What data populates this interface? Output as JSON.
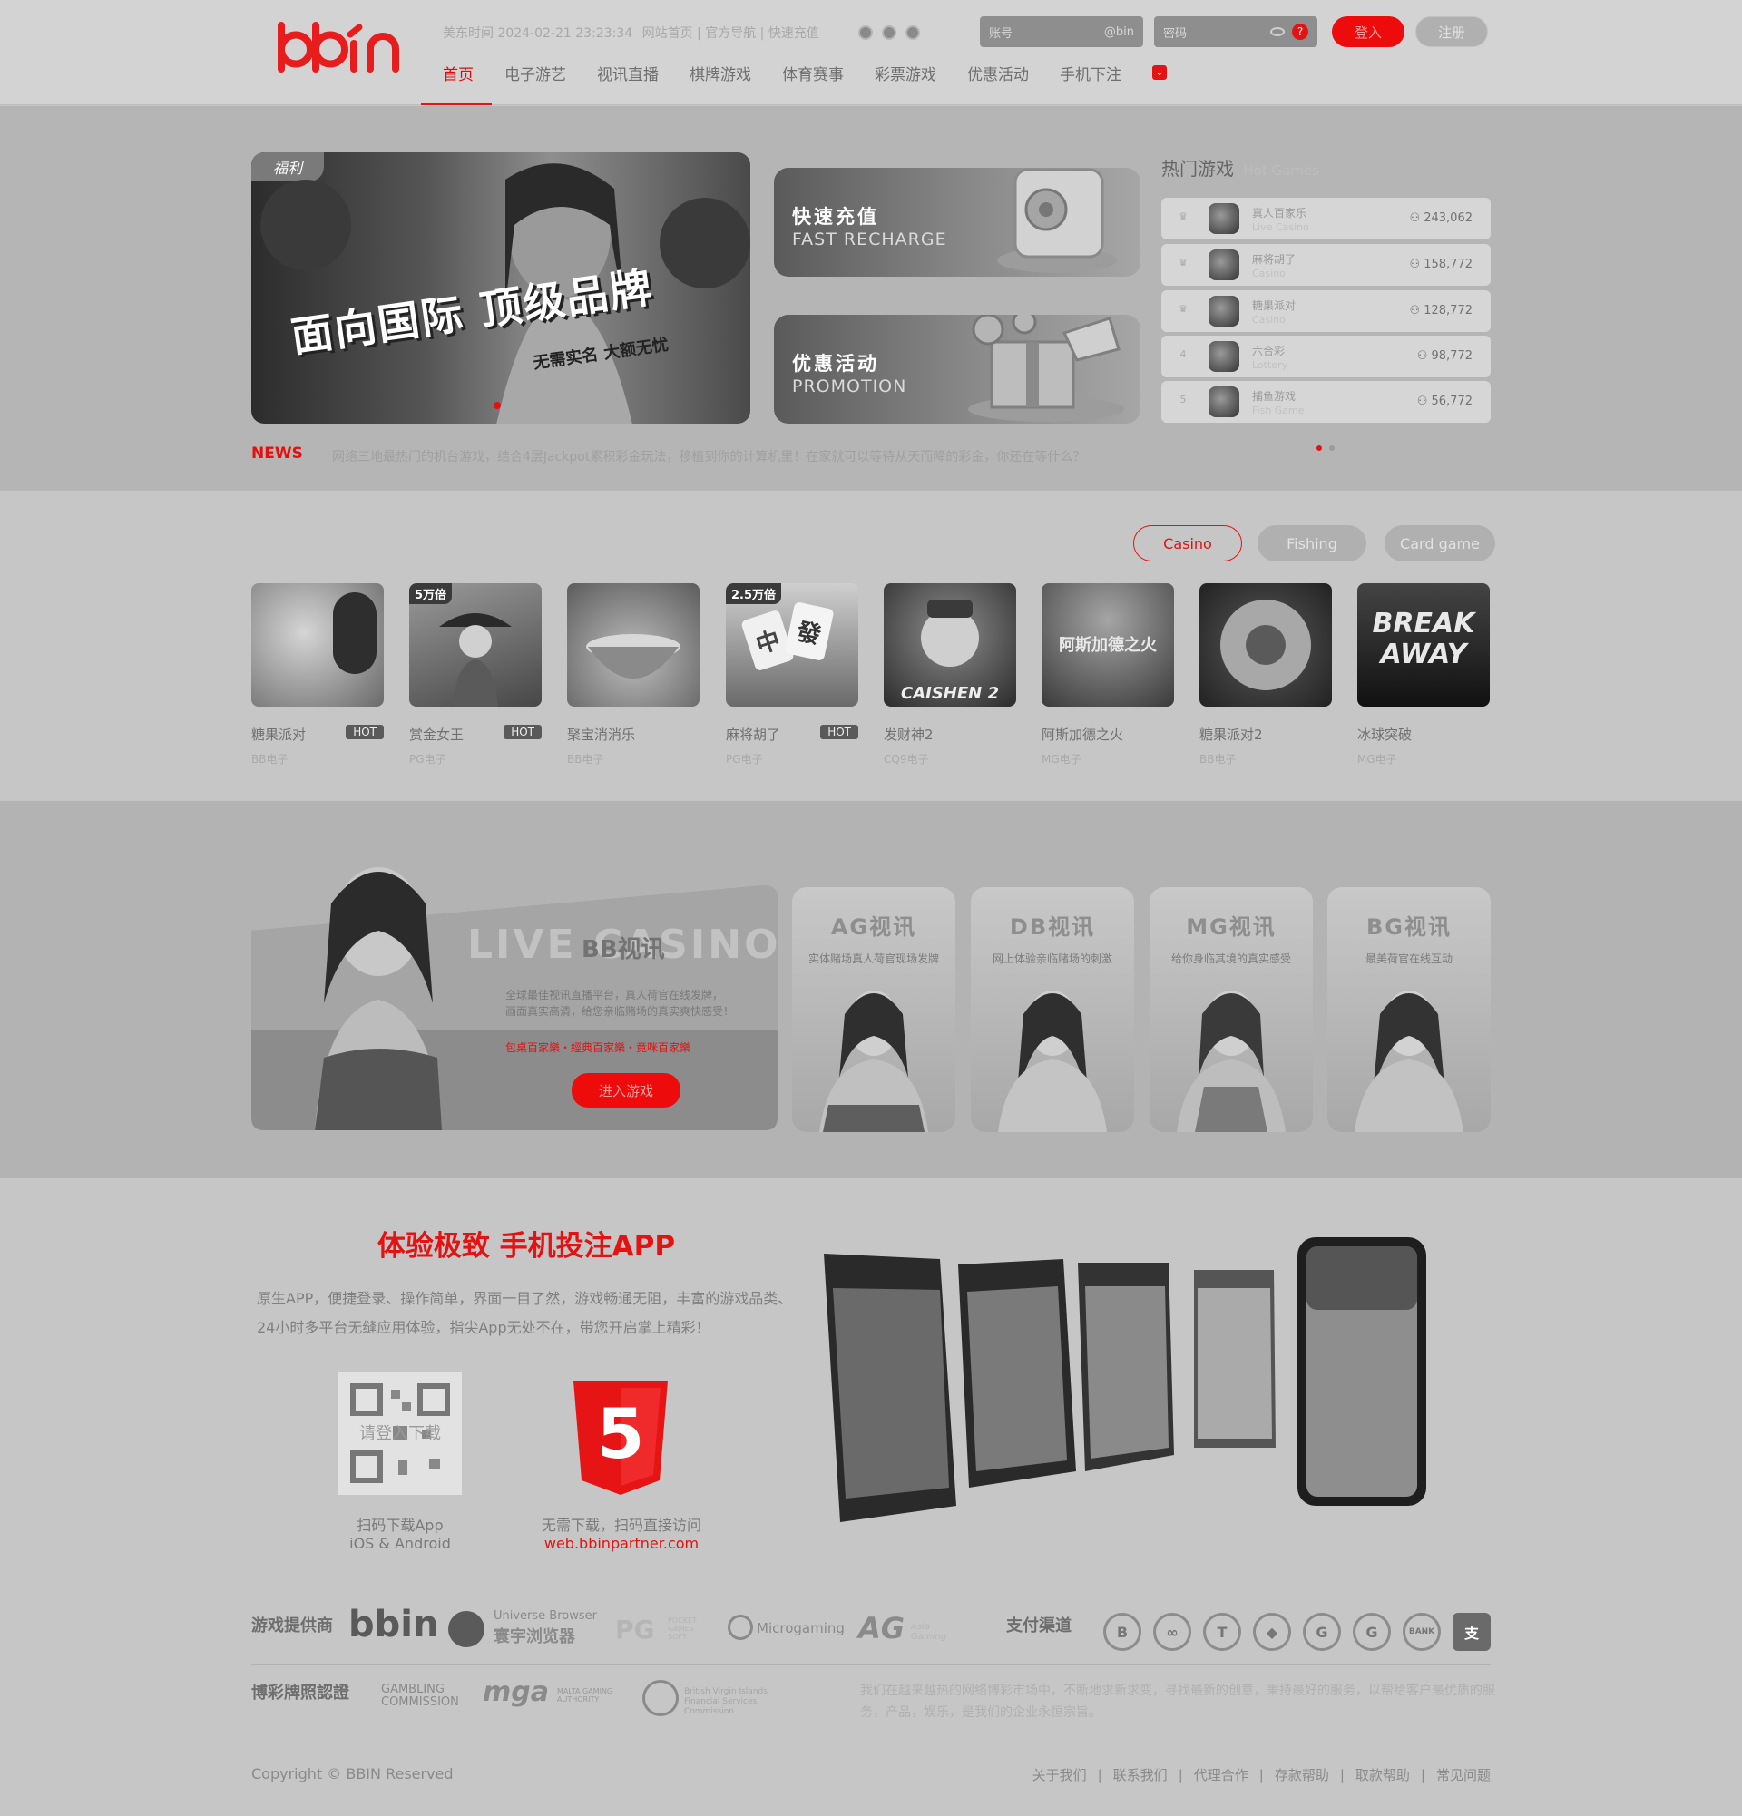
{
  "header": {
    "logo": "bbin",
    "time": "美东时间 2024-02-21 23:23:34",
    "links": "网站首页 | 官方导航 | 快速充值",
    "account_placeholder": "账号",
    "account_suffix": "@bin",
    "password_placeholder": "密码",
    "help_icon": "?",
    "login_label": "登入",
    "register_label": "注册"
  },
  "nav": [
    {
      "label": "首页",
      "active": true
    },
    {
      "label": "电子游艺"
    },
    {
      "label": "视讯直播"
    },
    {
      "label": "棋牌游戏"
    },
    {
      "label": "体育赛事"
    },
    {
      "label": "彩票游戏"
    },
    {
      "label": "优惠活动"
    },
    {
      "label": "手机下注"
    }
  ],
  "banner": {
    "tag": "福利",
    "headline": "面向国际 顶级品牌",
    "sub": "无需实名 大额无忧"
  },
  "promos": [
    {
      "title": "快速充值",
      "subtitle": "FAST RECHARGE"
    },
    {
      "title": "优惠活动",
      "subtitle": "PROMOTION"
    }
  ],
  "hot_games": {
    "title": "热门游戏",
    "subtitle": "Hot Games",
    "items": [
      {
        "rank": "1",
        "name": "真人百家乐",
        "cat": "Live Casino",
        "count": "243,062"
      },
      {
        "rank": "2",
        "name": "麻将胡了",
        "cat": "Casino",
        "count": "158,772"
      },
      {
        "rank": "3",
        "name": "糖果派对",
        "cat": "Casino",
        "count": "128,772"
      },
      {
        "rank": "4",
        "name": "六合彩",
        "cat": "Lottery",
        "count": "98,772"
      },
      {
        "rank": "5",
        "name": "捕鱼游戏",
        "cat": "Fish Game",
        "count": "56,772"
      }
    ]
  },
  "news": {
    "label": "NEWS",
    "text": "网络三地最热门的机台游戏，结合4层Jackpot累积彩金玩法，移植到你的计算机里！在家就可以等待从天而降的彩金，你还在等什么？"
  },
  "game_tabs": [
    "Casino",
    "Fishing",
    "Card game"
  ],
  "games": [
    {
      "name": "糖果派对",
      "vendor": "BB电子",
      "hot": "HOT",
      "badge": ""
    },
    {
      "name": "赏金女王",
      "vendor": "PG电子",
      "hot": "HOT",
      "badge": "5万倍"
    },
    {
      "name": "聚宝消消乐",
      "vendor": "BB电子",
      "hot": "",
      "badge": ""
    },
    {
      "name": "麻将胡了",
      "vendor": "PG电子",
      "hot": "HOT",
      "badge": "2.5万倍"
    },
    {
      "name": "发财神2",
      "vendor": "CQ9电子",
      "hot": "",
      "badge": ""
    },
    {
      "name": "阿斯加德之火",
      "vendor": "MG电子",
      "hot": "",
      "badge": ""
    },
    {
      "name": "糖果派对2",
      "vendor": "BB电子",
      "hot": "",
      "badge": ""
    },
    {
      "name": "冰球突破",
      "vendor": "MG电子",
      "hot": "",
      "badge": ""
    }
  ],
  "game_art": [
    "",
    "",
    "",
    "中 發",
    "CAISHEN 2",
    "阿斯加德之火",
    "",
    "BREAK AWAY"
  ],
  "live": {
    "bg_text": "LIVE CASINO",
    "title": "BB视讯",
    "desc1": "全球最佳视讯直播平台，真人荷官在线发牌，",
    "desc2": "画面真实高清，给您亲临赌场的真实爽快感受！",
    "games": "包桌百家樂・經典百家樂・竟咪百家樂",
    "button": "进入游戏",
    "cards": [
      {
        "title": "AG视讯",
        "sub": "实体赌场真人荷官现场发牌"
      },
      {
        "title": "DB视讯",
        "sub": "网上体验亲临赌场的刺激"
      },
      {
        "title": "MG视讯",
        "sub": "给你身临其境的真实感受"
      },
      {
        "title": "BG视讯",
        "sub": "最美荷官在线互动"
      }
    ]
  },
  "app": {
    "title": "体验极致 手机投注APP",
    "desc1": "原生APP，便捷登录、操作简单，界面一目了然，游戏畅通无阻，丰富的游戏品类、",
    "desc2": "24小时多平台无缝应用体验，指尖App无处不在，带您开启掌上精彩！",
    "qr_text": "请登入下载",
    "qr_caption1": "扫码下载App",
    "qr_caption2": "iOS & Android",
    "h5_caption1": "无需下载，扫码直接访问",
    "h5_url": "web.bbinpartner.com",
    "h5_symbol": "5"
  },
  "footer": {
    "providers_label": "游戏提供商",
    "providers": [
      "bbin",
      "Universe Browser",
      "寰宇浏览器",
      "PG",
      "POCKET GAMES SOFT",
      "Microgaming",
      "AG",
      "Asia Gaming"
    ],
    "payment_label": "支付渠道",
    "payments": [
      "B",
      "∞",
      "T",
      "◆",
      "G",
      "G",
      "BANK",
      "支"
    ],
    "license_label": "博彩牌照認證",
    "licenses": [
      "GAMBLING COMMISSION",
      "mga",
      "MALTA GAMING AUTHORITY",
      "British Virgin Islands Financial Services Commission"
    ],
    "about": "我们在越来越热的网络博彩市场中，不断地求新求变，寻找最新的创意，秉持最好的服务，以帮给客户最优质的服务，产品，娱乐，是我们的企业永恒宗旨。",
    "copyright": "Copyright © BBIN Reserved",
    "links": [
      "关于我们",
      "联系我们",
      "代理合作",
      "存款帮助",
      "取款帮助",
      "常见问题"
    ]
  }
}
